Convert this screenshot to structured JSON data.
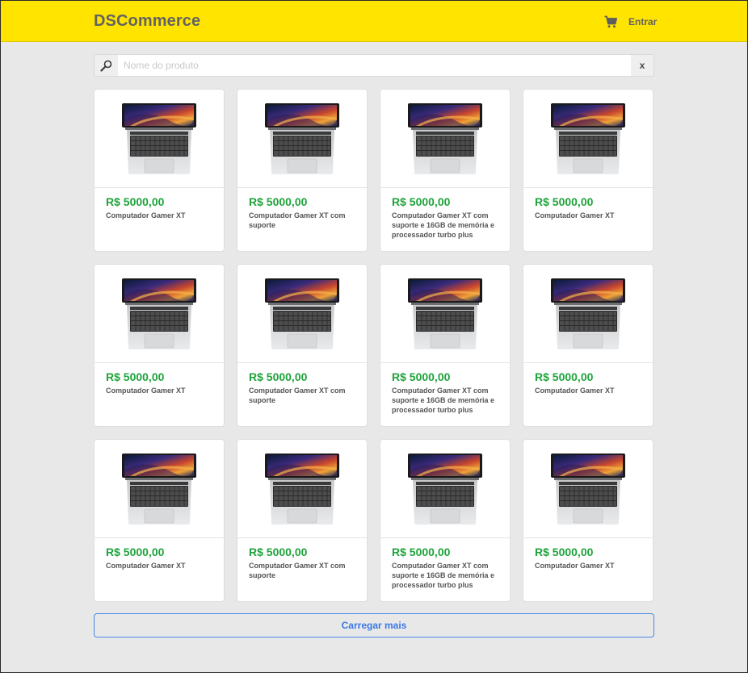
{
  "header": {
    "brand": "DSCommerce",
    "cart_icon": "cart-icon",
    "login_label": "Entrar",
    "accent_color": "#ffe400"
  },
  "search": {
    "placeholder": "Nome do produto",
    "value": "",
    "search_icon": "search-icon",
    "clear_label": "x"
  },
  "products": [
    {
      "price": "R$ 5000,00",
      "name": "Computador Gamer XT"
    },
    {
      "price": "R$ 5000,00",
      "name": "Computador Gamer XT com suporte"
    },
    {
      "price": "R$ 5000,00",
      "name": "Computador Gamer XT com suporte e 16GB de memória e processador turbo plus"
    },
    {
      "price": "R$ 5000,00",
      "name": "Computador Gamer XT"
    },
    {
      "price": "R$ 5000,00",
      "name": "Computador Gamer XT"
    },
    {
      "price": "R$ 5000,00",
      "name": "Computador Gamer XT com suporte"
    },
    {
      "price": "R$ 5000,00",
      "name": "Computador Gamer XT com suporte e 16GB de memória e processador turbo plus"
    },
    {
      "price": "R$ 5000,00",
      "name": "Computador Gamer XT"
    },
    {
      "price": "R$ 5000,00",
      "name": "Computador Gamer XT"
    },
    {
      "price": "R$ 5000,00",
      "name": "Computador Gamer XT com suporte"
    },
    {
      "price": "R$ 5000,00",
      "name": "Computador Gamer XT com suporte e 16GB de memória e processador turbo plus"
    },
    {
      "price": "R$ 5000,00",
      "name": "Computador Gamer XT"
    }
  ],
  "price_color": "#1ea33b",
  "load_more_label": "Carregar mais",
  "load_more_color": "#3b78e7"
}
